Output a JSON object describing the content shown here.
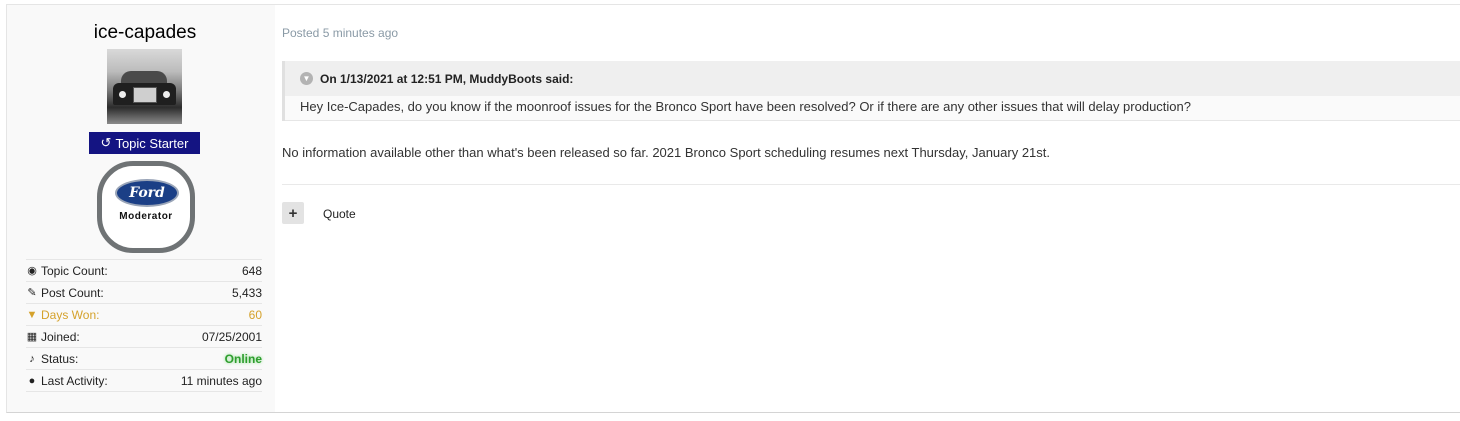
{
  "author": {
    "username": "ice-capades",
    "badge_label": "Topic Starter",
    "role_badge_logo_text": "Ford",
    "role_badge_text": "Moderator",
    "stats": [
      {
        "label": "Topic Count:",
        "value": "648",
        "icon": "comments-icon"
      },
      {
        "label": "Post Count:",
        "value": "5,433",
        "icon": "edit-icon"
      },
      {
        "label": "Days Won:",
        "value": "60",
        "icon": "trophy-icon",
        "color": "#d5a22c"
      },
      {
        "label": "Joined:",
        "value": "07/25/2001",
        "icon": "calendar-icon"
      },
      {
        "label": "Status:",
        "value": "Online",
        "icon": "bell-icon",
        "color": "#2e9e2e"
      },
      {
        "label": "Last Activity:",
        "value": "11 minutes ago",
        "icon": "map-marker-icon"
      }
    ]
  },
  "post": {
    "posted": "Posted 5 minutes ago",
    "quote": {
      "header": "On 1/13/2021 at 12:51 PM, MuddyBoots said:",
      "text": "Hey Ice-Capades, do you know if the moonroof issues for the Bronco Sport have been resolved? Or if there are any other issues that will delay production?"
    },
    "body": "No information available other than what's been released so far. 2021 Bronco Sport scheduling resumes next Thursday, January 21st.",
    "actions": {
      "multiquote": "+",
      "quote": "Quote"
    }
  }
}
